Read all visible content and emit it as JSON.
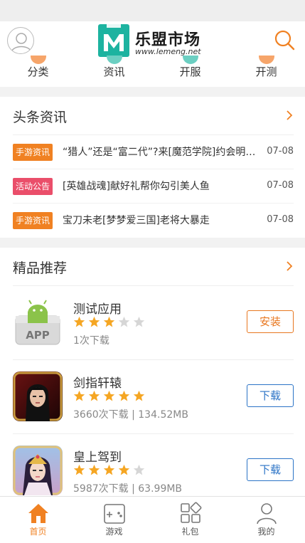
{
  "header": {
    "logo_title": "乐盟市场",
    "logo_url": "www.lemeng.net",
    "brand_color": "#1db3a0",
    "accent_color": "#f08122"
  },
  "quicknav": {
    "items": [
      {
        "label": "分类",
        "icon": "category-icon",
        "color": "#f08122"
      },
      {
        "label": "资讯",
        "icon": "news-icon",
        "color": "#1db3a0"
      },
      {
        "label": "开服",
        "icon": "server-open-icon",
        "color": "#1db3a0"
      },
      {
        "label": "开测",
        "icon": "beta-test-icon",
        "color": "#f08122"
      }
    ]
  },
  "headline_news": {
    "title": "头条资讯",
    "items": [
      {
        "tag": "手游资讯",
        "tag_color": "#f08122",
        "title": "“猎人”还是“富二代”?来[魔范学院]约会明星姐妹",
        "date": "07-08"
      },
      {
        "tag": "活动公告",
        "tag_color": "#ea4e6a",
        "title": "[英雄战魂]献好礼帮你勾引美人鱼",
        "date": "07-08"
      },
      {
        "tag": "手游资讯",
        "tag_color": "#f08122",
        "title": "宝刀未老[梦梦爱三国]老将大暴走",
        "date": "07-08"
      }
    ]
  },
  "featured": {
    "title": "精品推荐",
    "apps": [
      {
        "name": "测试应用",
        "rating": 3,
        "downloads": "1次下载",
        "size": "",
        "button": "安装",
        "button_type": "install",
        "icon": "app-package-icon"
      },
      {
        "name": "剑指轩辕",
        "rating": 5,
        "downloads": "3660次下载",
        "size": "134.52MB",
        "button": "下载",
        "button_type": "download",
        "icon": "game-warrior-icon"
      },
      {
        "name": "皇上驾到",
        "rating": 4,
        "downloads": "5987次下载",
        "size": "63.99MB",
        "button": "下载",
        "button_type": "download",
        "icon": "game-empress-icon"
      }
    ]
  },
  "tabbar": {
    "items": [
      {
        "label": "首页",
        "icon": "home-icon",
        "active": true
      },
      {
        "label": "游戏",
        "icon": "gamepad-icon",
        "active": false
      },
      {
        "label": "礼包",
        "icon": "gift-grid-icon",
        "active": false
      },
      {
        "label": "我的",
        "icon": "user-icon",
        "active": false
      }
    ]
  }
}
